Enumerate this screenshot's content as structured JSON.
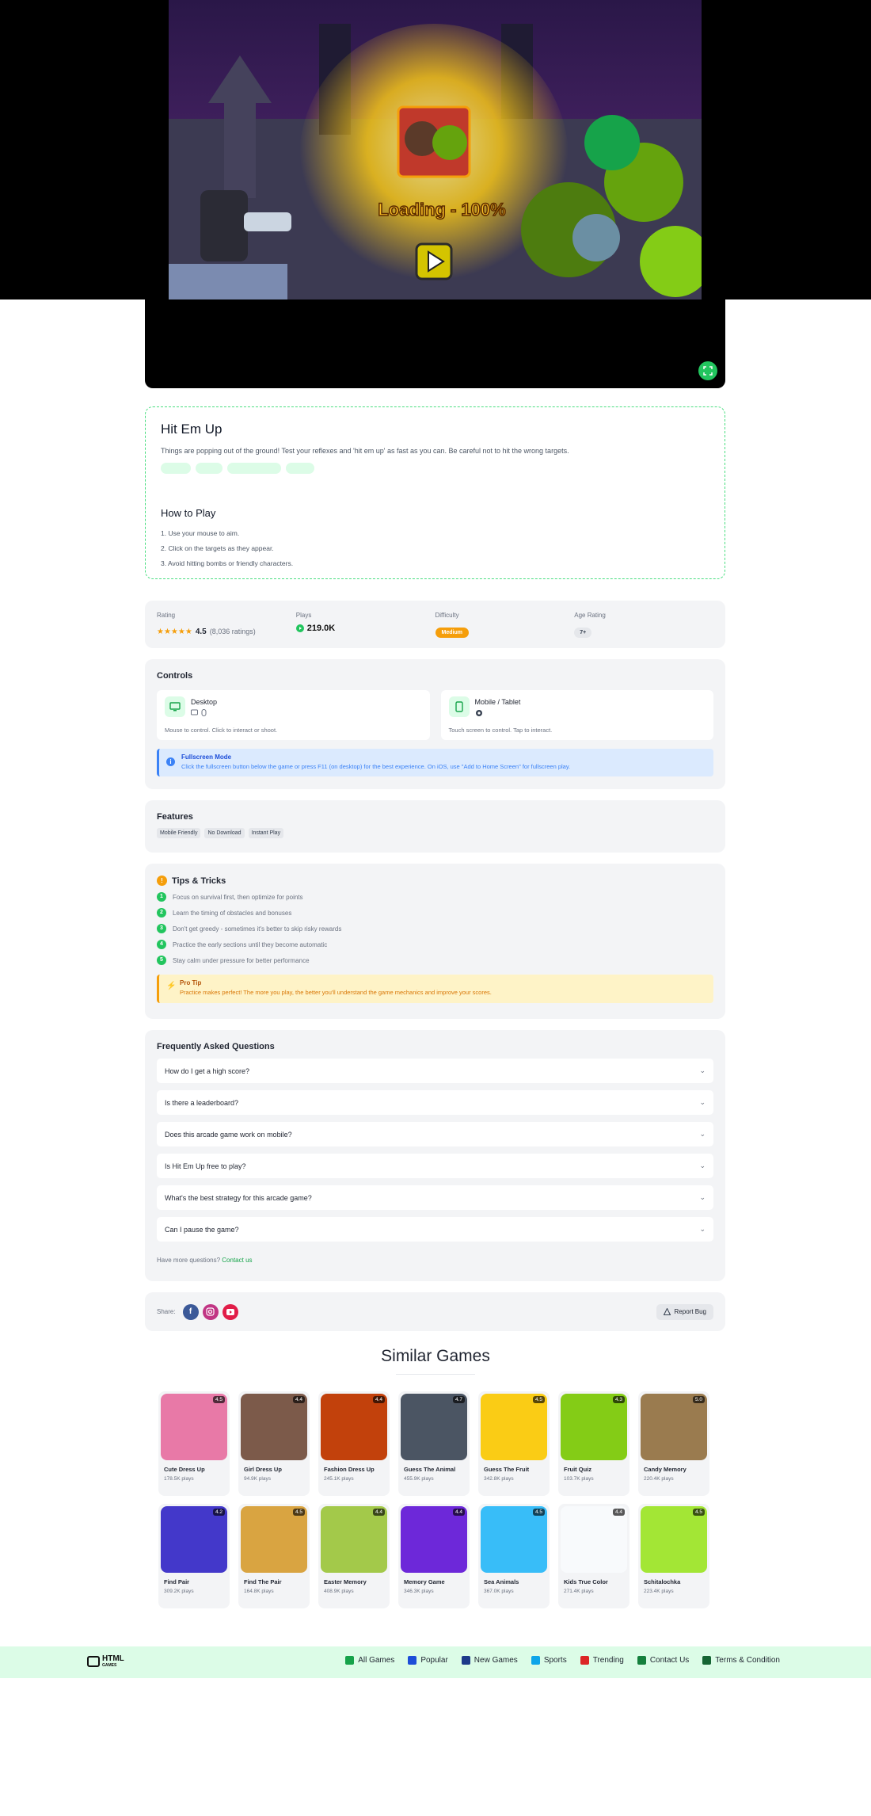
{
  "player": {
    "loading_text": "Loading - 100%"
  },
  "game": {
    "title": "Hit Em Up",
    "description": "Things are popping out of the ground! Test your reflexes and 'hit em up' as fast as you can. Be careful not to hit the wrong targets.",
    "how_to_play_title": "How to Play",
    "steps": [
      "1. Use your mouse to aim.",
      "2. Click on the targets as they appear.",
      "3. Avoid hitting bombs or friendly characters."
    ]
  },
  "stats": {
    "rating_label": "Rating",
    "rating_stars": "★★★★★",
    "rating_value": "4.5",
    "rating_count": "(8,036 ratings)",
    "plays_label": "Plays",
    "plays_value": "219.0K",
    "difficulty_label": "Difficulty",
    "difficulty_value": "Medium",
    "age_label": "Age Rating",
    "age_value": "7+"
  },
  "controls": {
    "title": "Controls",
    "desktop_name": "Desktop",
    "desktop_desc": "Mouse to control. Click to interact or shoot.",
    "mobile_name": "Mobile / Tablet",
    "mobile_desc": "Touch screen to control. Tap to interact.",
    "fullscreen_title": "Fullscreen Mode",
    "fullscreen_text": "Click the fullscreen button below the game or press F11 (on desktop) for the best experience. On iOS, use \"Add to Home Screen\" for fullscreen play."
  },
  "features": {
    "title": "Features",
    "items": [
      "Mobile Friendly",
      "No Download",
      "Instant Play"
    ]
  },
  "tips": {
    "title": "Tips & Tricks",
    "items": [
      "Focus on survival first, then optimize for points",
      "Learn the timing of obstacles and bonuses",
      "Don't get greedy - sometimes it's better to skip risky rewards",
      "Practice the early sections until they become automatic",
      "Stay calm under pressure for better performance"
    ],
    "pro_title": "Pro Tip",
    "pro_text": "Practice makes perfect! The more you play, the better you'll understand the game mechanics and improve your scores."
  },
  "faq": {
    "title": "Frequently Asked Questions",
    "items": [
      "How do I get a high score?",
      "Is there a leaderboard?",
      "Does this arcade game work on mobile?",
      "Is Hit Em Up free to play?",
      "What's the best strategy for this arcade game?",
      "Can I pause the game?"
    ],
    "foot_text": "Have more questions?",
    "contact_link": "Contact us"
  },
  "share": {
    "label": "Share:",
    "report_label": "Report Bug"
  },
  "similar": {
    "title": "Similar Games",
    "games": [
      {
        "name": "Cute Dress Up",
        "plays": "178.5K plays",
        "rating": "4.5",
        "color": "#e879a7"
      },
      {
        "name": "Girl Dress Up",
        "plays": "94.9K plays",
        "rating": "4.4",
        "color": "#7c5a4a"
      },
      {
        "name": "Fashion Dress Up",
        "plays": "245.1K plays",
        "rating": "4.4",
        "color": "#c2410c"
      },
      {
        "name": "Guess The Animal",
        "plays": "455.9K plays",
        "rating": "4.7",
        "color": "#4b5563"
      },
      {
        "name": "Guess The Fruit",
        "plays": "342.8K plays",
        "rating": "4.5",
        "color": "#facc15"
      },
      {
        "name": "Fruit Quiz",
        "plays": "103.7K plays",
        "rating": "4.3",
        "color": "#84cc16"
      },
      {
        "name": "Candy Memory",
        "plays": "220.4K plays",
        "rating": "5.0",
        "color": "#9a7b4f"
      },
      {
        "name": "Find Pair",
        "plays": "309.2K plays",
        "rating": "4.2",
        "color": "#4338ca"
      },
      {
        "name": "Find The Pair",
        "plays": "164.8K plays",
        "rating": "4.5",
        "color": "#d9a441"
      },
      {
        "name": "Easter Memory",
        "plays": "408.9K plays",
        "rating": "4.4",
        "color": "#a3c94a"
      },
      {
        "name": "Memory Game",
        "plays": "346.3K plays",
        "rating": "4.4",
        "color": "#6d28d9"
      },
      {
        "name": "Sea Animals",
        "plays": "367.0K plays",
        "rating": "4.5",
        "color": "#38bdf8"
      },
      {
        "name": "Kids True Color",
        "plays": "271.4K plays",
        "rating": "4.4",
        "color": "#f8fafc"
      },
      {
        "name": "Schitalochka",
        "plays": "223.4K plays",
        "rating": "4.5",
        "color": "#a3e635"
      }
    ]
  },
  "footer": {
    "logo": "HTML",
    "logo_sub": "GAMES",
    "nav": [
      "All Games",
      "Popular",
      "New Games",
      "Sports",
      "Trending",
      "Contact Us",
      "Terms & Condition"
    ],
    "nav_colors": [
      "#16a34a",
      "#1d4ed8",
      "#1e3a8a",
      "#0ea5e9",
      "#dc2626",
      "#15803d",
      "#166534"
    ]
  }
}
